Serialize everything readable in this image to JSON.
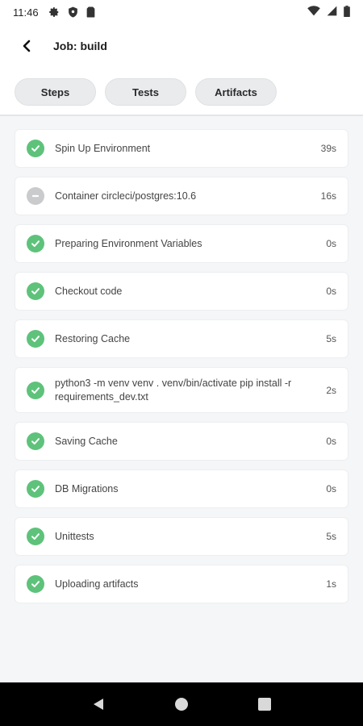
{
  "status_bar": {
    "time": "11:46"
  },
  "header": {
    "title": "Job: build"
  },
  "tabs": [
    {
      "label": "Steps"
    },
    {
      "label": "Tests"
    },
    {
      "label": "Artifacts"
    }
  ],
  "steps": [
    {
      "label": "Spin Up Environment",
      "duration": "39s",
      "status": "success"
    },
    {
      "label": "Container circleci/postgres:10.6",
      "duration": "16s",
      "status": "neutral"
    },
    {
      "label": "Preparing Environment Variables",
      "duration": "0s",
      "status": "success"
    },
    {
      "label": "Checkout code",
      "duration": "0s",
      "status": "success"
    },
    {
      "label": "Restoring Cache",
      "duration": "5s",
      "status": "success"
    },
    {
      "label": "python3 -m venv venv . venv/bin/activate pip install -r requirements_dev.txt",
      "duration": "2s",
      "status": "success"
    },
    {
      "label": "Saving Cache",
      "duration": "0s",
      "status": "success"
    },
    {
      "label": "DB Migrations",
      "duration": "0s",
      "status": "success"
    },
    {
      "label": "Unittests",
      "duration": "5s",
      "status": "success"
    },
    {
      "label": "Uploading artifacts",
      "duration": "1s",
      "status": "success"
    }
  ],
  "colors": {
    "success": "#5ec27b",
    "neutral": "#c9cbcd",
    "background": "#f5f6f7"
  },
  "icons": [
    "settings-icon",
    "shield-icon",
    "sim-card-icon",
    "wifi-icon",
    "signal-icon",
    "battery-icon",
    "back-arrow-icon",
    "check-icon",
    "minus-icon",
    "nav-back-icon",
    "nav-home-icon",
    "nav-recents-icon"
  ]
}
